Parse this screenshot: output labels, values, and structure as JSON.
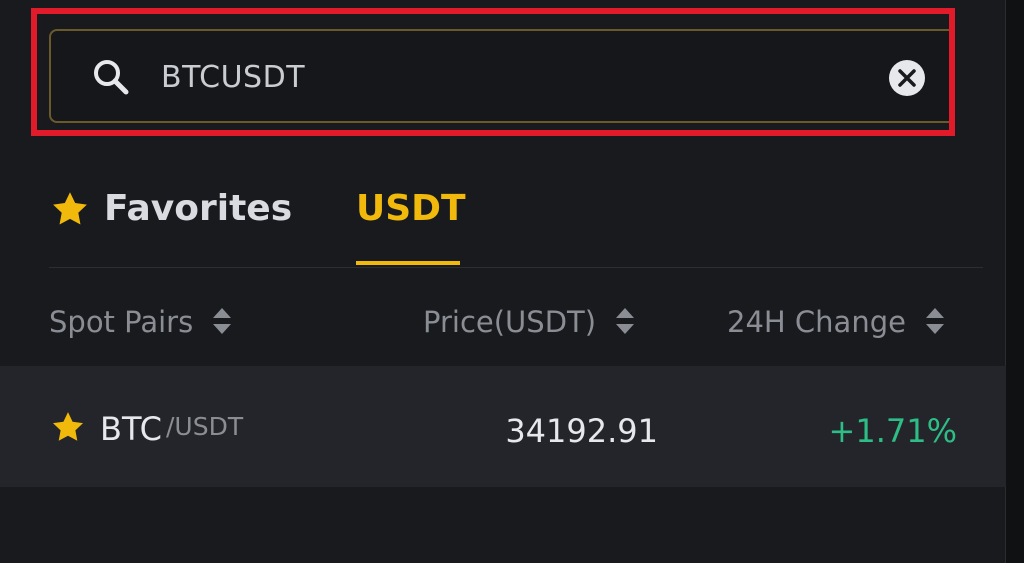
{
  "search": {
    "value": "BTCUSDT",
    "icon": "search-icon",
    "clear_icon": "clear-icon"
  },
  "tabs": [
    {
      "label": "Favorites",
      "icon": "star-icon",
      "active": false
    },
    {
      "label": "USDT",
      "active": true
    }
  ],
  "columns": [
    {
      "label": "Spot Pairs",
      "icon": "sort-icon"
    },
    {
      "label": "Price(USDT)",
      "icon": "sort-icon"
    },
    {
      "label": "24H Change",
      "icon": "sort-icon"
    }
  ],
  "rows": [
    {
      "base": "BTC",
      "quote": "/USDT",
      "price": "34192.91",
      "change": "+1.71%",
      "favorite": true
    }
  ],
  "colors": {
    "accent": "#f0b90b",
    "positive": "#2ebd85",
    "highlight_border": "#e21b2b",
    "background": "#181a1e"
  }
}
